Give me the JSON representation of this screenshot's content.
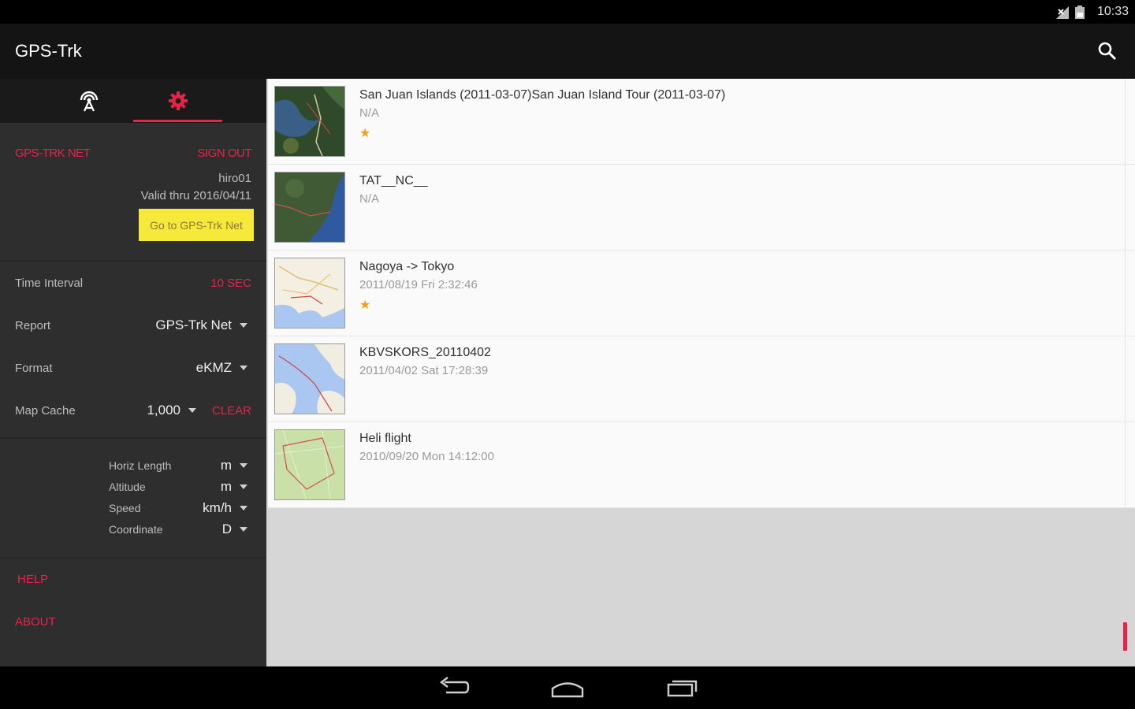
{
  "status_bar": {
    "time": "10:33"
  },
  "app_bar": {
    "title": "GPS-Trk"
  },
  "sidebar": {
    "account": {
      "service_label": "GPS-TRK NET",
      "sign_out_label": "SIGN OUT",
      "username": "hiro01",
      "valid_text": "Valid thru 2016/04/11",
      "goto_button": "Go to GPS-Trk Net"
    },
    "settings": {
      "time_interval_label": "Time Interval",
      "time_interval_value": "10 SEC",
      "report_label": "Report",
      "report_value": "GPS-Trk Net",
      "format_label": "Format",
      "format_value": "eKMZ",
      "map_cache_label": "Map Cache",
      "map_cache_value": "1,000",
      "clear_label": "CLEAR"
    },
    "units": [
      {
        "label": "Horiz Length",
        "value": "m"
      },
      {
        "label": "Altitude",
        "value": "m"
      },
      {
        "label": "Speed",
        "value": "km/h"
      },
      {
        "label": "Coordinate",
        "value": "D"
      }
    ],
    "help_label": "HELP",
    "about_label": "ABOUT"
  },
  "tracks": [
    {
      "title": "San Juan Islands (2011-03-07)San Juan Island Tour (2011-03-07)",
      "subtitle": "N/A",
      "starred": true,
      "thumb": "satellite"
    },
    {
      "title": "TAT__NC__",
      "subtitle": "N/A",
      "starred": false,
      "thumb": "satellite-coast"
    },
    {
      "title": "Nagoya -> Tokyo",
      "subtitle": "2011/08/19 Fri  2:32:46",
      "starred": true,
      "thumb": "road-map"
    },
    {
      "title": "KBVSKORS_20110402",
      "subtitle": "2011/04/02 Sat  17:28:39",
      "starred": false,
      "thumb": "island-map"
    },
    {
      "title": "Heli flight",
      "subtitle": "2010/09/20 Mon  14:12:00",
      "starred": false,
      "thumb": "terrain-map"
    }
  ],
  "colors": {
    "accent": "#e8234a",
    "button_yellow": "#f6e93a",
    "star": "#f0a020"
  }
}
